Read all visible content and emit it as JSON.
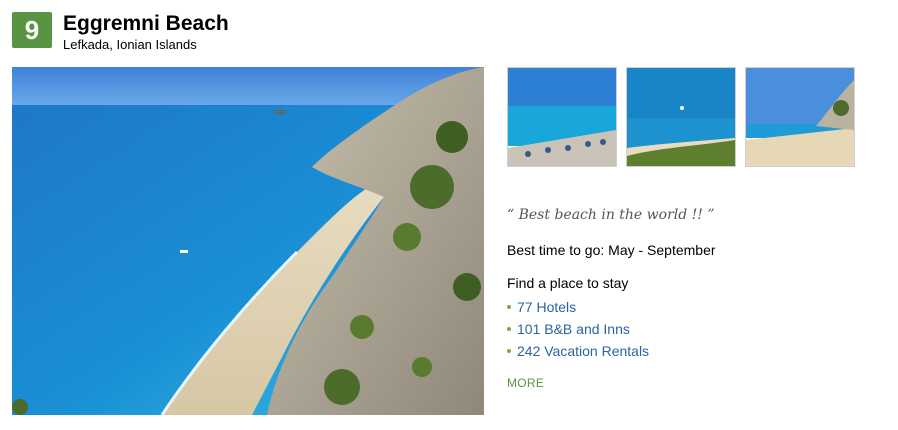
{
  "header": {
    "rank": "9",
    "title": "Eggremni Beach",
    "location": "Lefkada, Ionian Islands"
  },
  "quote": "“ Best beach in the world !! ”",
  "best_time": "Best time to go: May - September",
  "stay": {
    "heading": "Find a place to stay",
    "items": [
      {
        "label": "77 Hotels"
      },
      {
        "label": "101 B&B and Inns"
      },
      {
        "label": "242 Vacation Rentals"
      }
    ]
  },
  "more_label": "MORE",
  "colors": {
    "badge": "#589442",
    "link": "#2a64a0",
    "more": "#589442"
  }
}
